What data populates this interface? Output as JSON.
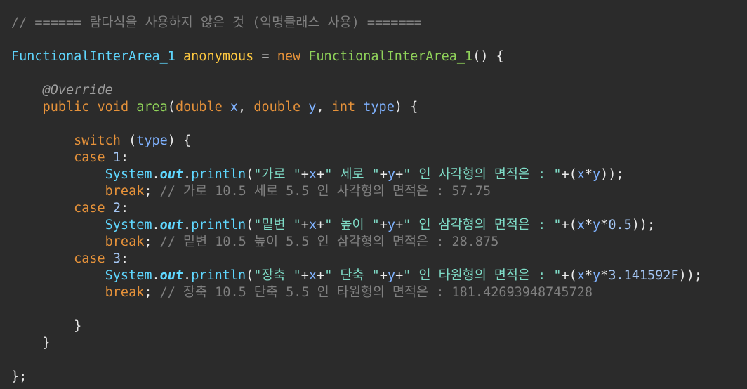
{
  "editor": {
    "theme": {
      "background": "#2b2b2b",
      "comment": "#808080",
      "type": "#5fd7ff",
      "keyword": "#e6923a",
      "annotation": "#9e9e9e",
      "string": "#7fdcc7",
      "number": "#a5c7f5",
      "method": "#90d35a",
      "variable": "#7fb2ff",
      "anonymous": "#ffc940",
      "static_field": "#5fd7ff",
      "plain": "#eaeaea"
    },
    "lines": [
      [
        {
          "t": "comment",
          "v": "// ====== 람다식을 사용하지 않은 것 (익명클래스 사용) ======="
        }
      ],
      [],
      [
        {
          "t": "type",
          "v": "FunctionalInterArea_1"
        },
        {
          "t": "plain",
          "v": " "
        },
        {
          "t": "anon",
          "v": "anonymous"
        },
        {
          "t": "plain",
          "v": " = "
        },
        {
          "t": "kw",
          "v": "new"
        },
        {
          "t": "plain",
          "v": " "
        },
        {
          "t": "method",
          "v": "FunctionalInterArea_1"
        },
        {
          "t": "plain",
          "v": "() {"
        }
      ],
      [],
      [
        {
          "t": "plain",
          "v": "    "
        },
        {
          "t": "ann",
          "v": "@Override"
        }
      ],
      [
        {
          "t": "plain",
          "v": "    "
        },
        {
          "t": "kw",
          "v": "public"
        },
        {
          "t": "plain",
          "v": " "
        },
        {
          "t": "kw",
          "v": "void"
        },
        {
          "t": "plain",
          "v": " "
        },
        {
          "t": "method",
          "v": "area"
        },
        {
          "t": "plain",
          "v": "("
        },
        {
          "t": "kw",
          "v": "double"
        },
        {
          "t": "plain",
          "v": " "
        },
        {
          "t": "var",
          "v": "x"
        },
        {
          "t": "plain",
          "v": ", "
        },
        {
          "t": "kw",
          "v": "double"
        },
        {
          "t": "plain",
          "v": " "
        },
        {
          "t": "var",
          "v": "y"
        },
        {
          "t": "plain",
          "v": ", "
        },
        {
          "t": "kw",
          "v": "int"
        },
        {
          "t": "plain",
          "v": " "
        },
        {
          "t": "var",
          "v": "type"
        },
        {
          "t": "plain",
          "v": ") {"
        }
      ],
      [],
      [
        {
          "t": "plain",
          "v": "        "
        },
        {
          "t": "kw",
          "v": "switch"
        },
        {
          "t": "plain",
          "v": " ("
        },
        {
          "t": "var",
          "v": "type"
        },
        {
          "t": "plain",
          "v": ") {"
        }
      ],
      [
        {
          "t": "plain",
          "v": "        "
        },
        {
          "t": "kw",
          "v": "case"
        },
        {
          "t": "plain",
          "v": " "
        },
        {
          "t": "num",
          "v": "1"
        },
        {
          "t": "plain",
          "v": ":"
        }
      ],
      [
        {
          "t": "plain",
          "v": "            "
        },
        {
          "t": "type",
          "v": "System"
        },
        {
          "t": "plain",
          "v": "."
        },
        {
          "t": "static",
          "v": "out"
        },
        {
          "t": "plain",
          "v": "."
        },
        {
          "t": "type",
          "v": "println"
        },
        {
          "t": "plain",
          "v": "("
        },
        {
          "t": "str",
          "v": "\"가로 \""
        },
        {
          "t": "plain",
          "v": "+"
        },
        {
          "t": "var",
          "v": "x"
        },
        {
          "t": "plain",
          "v": "+"
        },
        {
          "t": "str",
          "v": "\" 세로 \""
        },
        {
          "t": "plain",
          "v": "+"
        },
        {
          "t": "var",
          "v": "y"
        },
        {
          "t": "plain",
          "v": "+"
        },
        {
          "t": "str",
          "v": "\" 인 사각형의 면적은 : \""
        },
        {
          "t": "plain",
          "v": "+("
        },
        {
          "t": "var",
          "v": "x"
        },
        {
          "t": "plain",
          "v": "*"
        },
        {
          "t": "var",
          "v": "y"
        },
        {
          "t": "plain",
          "v": "));"
        }
      ],
      [
        {
          "t": "plain",
          "v": "            "
        },
        {
          "t": "kw",
          "v": "break"
        },
        {
          "t": "plain",
          "v": "; "
        },
        {
          "t": "comment",
          "v": "// 가로 10.5 세로 5.5 인 사각형의 면적은 : 57.75"
        }
      ],
      [
        {
          "t": "plain",
          "v": "        "
        },
        {
          "t": "kw",
          "v": "case"
        },
        {
          "t": "plain",
          "v": " "
        },
        {
          "t": "num",
          "v": "2"
        },
        {
          "t": "plain",
          "v": ":"
        }
      ],
      [
        {
          "t": "plain",
          "v": "            "
        },
        {
          "t": "type",
          "v": "System"
        },
        {
          "t": "plain",
          "v": "."
        },
        {
          "t": "static",
          "v": "out"
        },
        {
          "t": "plain",
          "v": "."
        },
        {
          "t": "type",
          "v": "println"
        },
        {
          "t": "plain",
          "v": "("
        },
        {
          "t": "str",
          "v": "\"밑변 \""
        },
        {
          "t": "plain",
          "v": "+"
        },
        {
          "t": "var",
          "v": "x"
        },
        {
          "t": "plain",
          "v": "+"
        },
        {
          "t": "str",
          "v": "\" 높이 \""
        },
        {
          "t": "plain",
          "v": "+"
        },
        {
          "t": "var",
          "v": "y"
        },
        {
          "t": "plain",
          "v": "+"
        },
        {
          "t": "str",
          "v": "\" 인 삼각형의 면적은 : \""
        },
        {
          "t": "plain",
          "v": "+("
        },
        {
          "t": "var",
          "v": "x"
        },
        {
          "t": "plain",
          "v": "*"
        },
        {
          "t": "var",
          "v": "y"
        },
        {
          "t": "plain",
          "v": "*"
        },
        {
          "t": "num",
          "v": "0.5"
        },
        {
          "t": "plain",
          "v": "));"
        }
      ],
      [
        {
          "t": "plain",
          "v": "            "
        },
        {
          "t": "kw",
          "v": "break"
        },
        {
          "t": "plain",
          "v": "; "
        },
        {
          "t": "comment",
          "v": "// 밑변 10.5 높이 5.5 인 삼각형의 면적은 : 28.875"
        }
      ],
      [
        {
          "t": "plain",
          "v": "        "
        },
        {
          "t": "kw",
          "v": "case"
        },
        {
          "t": "plain",
          "v": " "
        },
        {
          "t": "num",
          "v": "3"
        },
        {
          "t": "plain",
          "v": ":"
        }
      ],
      [
        {
          "t": "plain",
          "v": "            "
        },
        {
          "t": "type",
          "v": "System"
        },
        {
          "t": "plain",
          "v": "."
        },
        {
          "t": "static",
          "v": "out"
        },
        {
          "t": "plain",
          "v": "."
        },
        {
          "t": "type",
          "v": "println"
        },
        {
          "t": "plain",
          "v": "("
        },
        {
          "t": "str",
          "v": "\"장축 \""
        },
        {
          "t": "plain",
          "v": "+"
        },
        {
          "t": "var",
          "v": "x"
        },
        {
          "t": "plain",
          "v": "+"
        },
        {
          "t": "str",
          "v": "\" 단축 \""
        },
        {
          "t": "plain",
          "v": "+"
        },
        {
          "t": "var",
          "v": "y"
        },
        {
          "t": "plain",
          "v": "+"
        },
        {
          "t": "str",
          "v": "\" 인 타원형의 면적은 : \""
        },
        {
          "t": "plain",
          "v": "+("
        },
        {
          "t": "var",
          "v": "x"
        },
        {
          "t": "plain",
          "v": "*"
        },
        {
          "t": "var",
          "v": "y"
        },
        {
          "t": "plain",
          "v": "*"
        },
        {
          "t": "num",
          "v": "3.141592F"
        },
        {
          "t": "plain",
          "v": "));"
        }
      ],
      [
        {
          "t": "plain",
          "v": "            "
        },
        {
          "t": "kw",
          "v": "break"
        },
        {
          "t": "plain",
          "v": "; "
        },
        {
          "t": "comment",
          "v": "// 장축 10.5 단축 5.5 인 타원형의 면적은 : 181.42693948745728"
        }
      ],
      [],
      [
        {
          "t": "plain",
          "v": "        }"
        }
      ],
      [
        {
          "t": "plain",
          "v": "    }"
        }
      ],
      [],
      [
        {
          "t": "plain",
          "v": "};"
        }
      ]
    ]
  }
}
